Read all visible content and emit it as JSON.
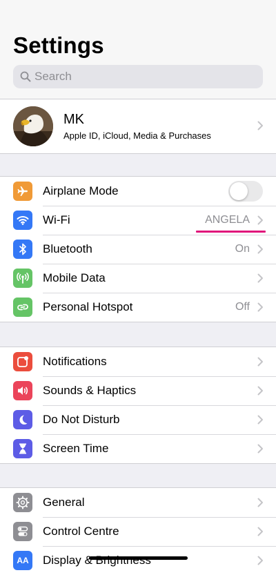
{
  "header": {
    "title": "Settings",
    "search_placeholder": "Search",
    "search_icon": "magnifier"
  },
  "profile": {
    "name": "MK",
    "subtitle": "Apple ID, iCloud, Media & Purchases",
    "avatar": "eagle photo"
  },
  "connectivity": [
    {
      "label": "Airplane Mode",
      "icon": "airplane-icon",
      "color": "#f09a37",
      "control": "toggle",
      "toggle_on": false
    },
    {
      "label": "Wi-Fi",
      "icon": "wifi-icon",
      "color": "#3478f6",
      "value": "ANGELA",
      "highlight": "#e0117a"
    },
    {
      "label": "Bluetooth",
      "icon": "bluetooth-icon",
      "color": "#3478f6",
      "value": "On"
    },
    {
      "label": "Mobile Data",
      "icon": "antenna-icon",
      "color": "#65c466",
      "value": ""
    },
    {
      "label": "Personal Hotspot",
      "icon": "hotspot-chain-icon",
      "color": "#65c466",
      "value": "Off"
    }
  ],
  "notifications_group": [
    {
      "label": "Notifications",
      "icon": "notifications-icon",
      "color": "#eb4d3d"
    },
    {
      "label": "Sounds & Haptics",
      "icon": "speaker-icon",
      "color": "#eb445a"
    },
    {
      "label": "Do Not Disturb",
      "icon": "moon-icon",
      "color": "#5d5ce6"
    },
    {
      "label": "Screen Time",
      "icon": "hourglass-icon",
      "color": "#5d5ce6"
    }
  ],
  "general_group": [
    {
      "label": "General",
      "icon": "gear-icon",
      "color": "#8e8e93"
    },
    {
      "label": "Control Centre",
      "icon": "switches-icon",
      "color": "#8e8e93"
    },
    {
      "label": "Display & Brightness",
      "icon": "text-size-icon",
      "color": "#3478f6",
      "icon_text": "AA"
    }
  ],
  "colors": {
    "background": "#efeff4",
    "secondary_text": "#8e8e93",
    "wifi_underline": "#e0117a"
  }
}
